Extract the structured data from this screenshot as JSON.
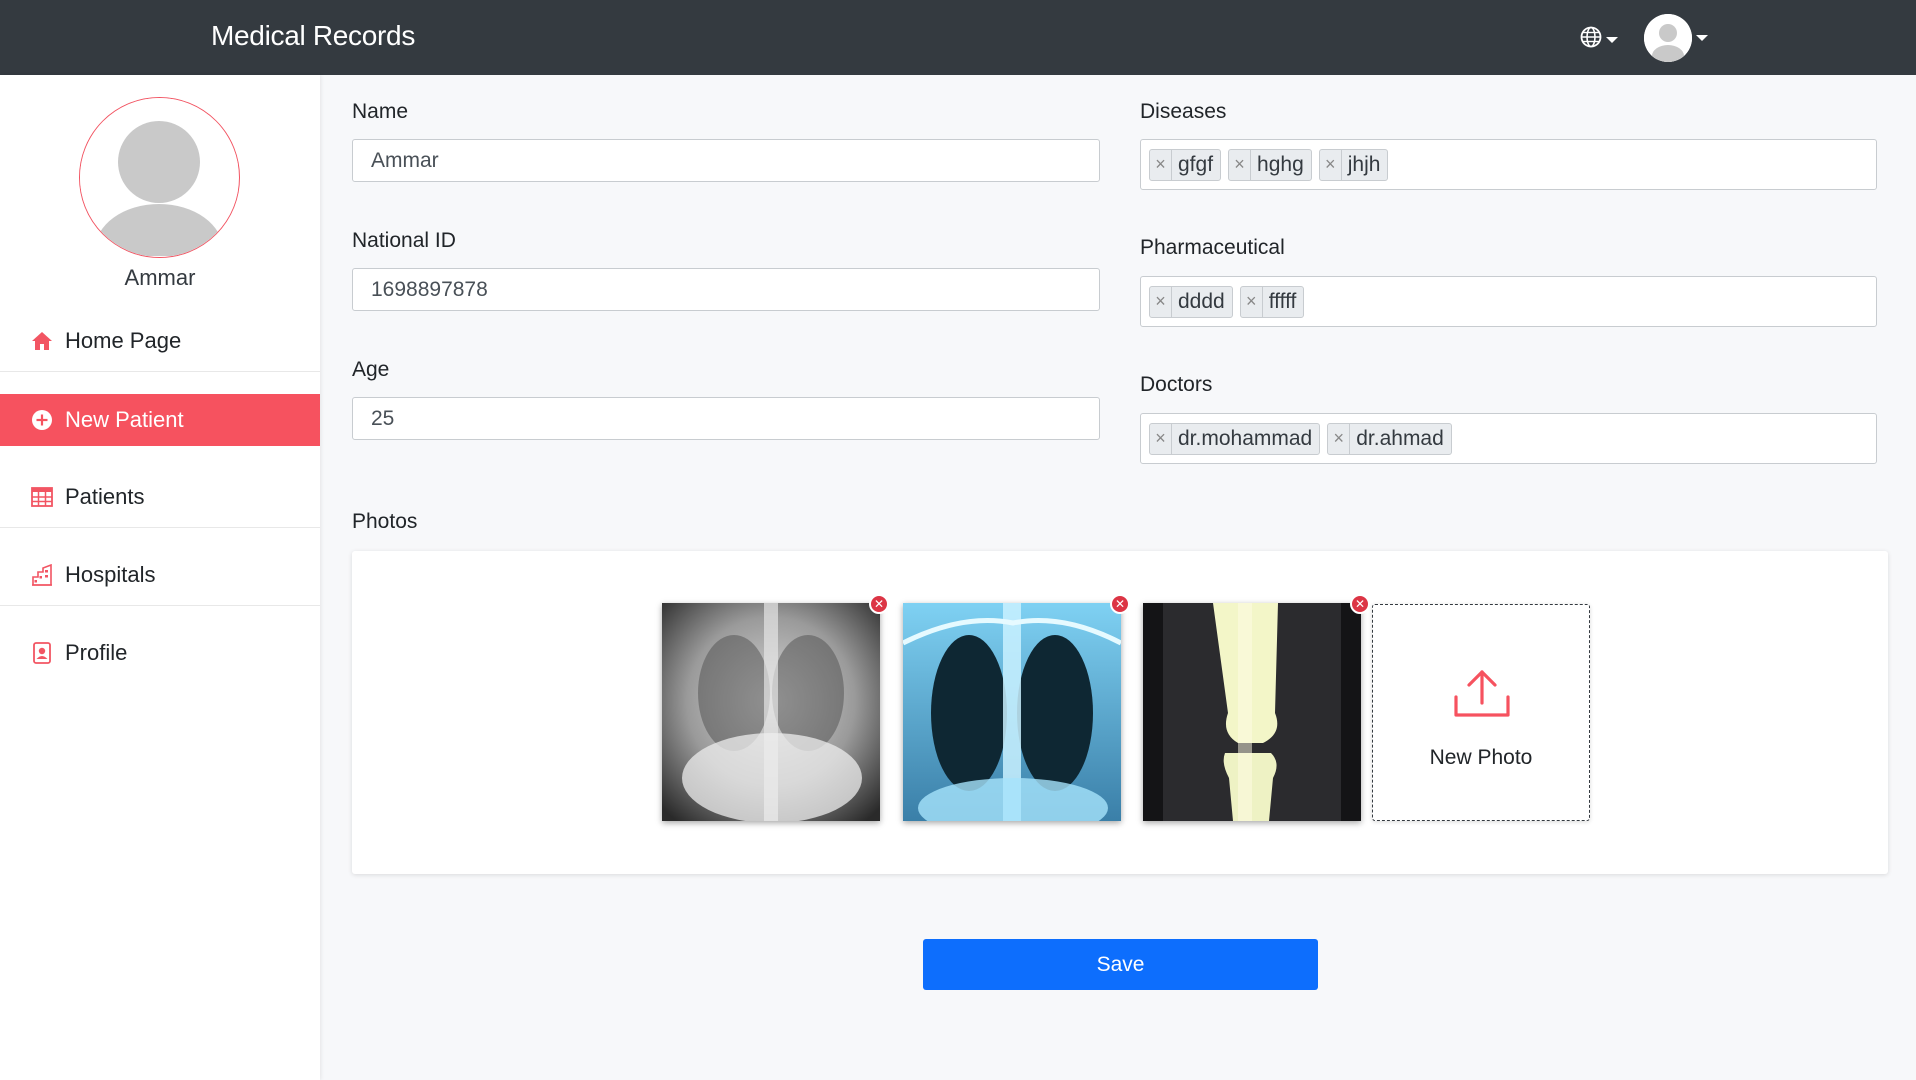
{
  "header": {
    "brand": "Medical Records",
    "language_icon": "globe-icon",
    "user_icon": "user-avatar"
  },
  "sidebar": {
    "username": "Ammar",
    "items": [
      {
        "label": "Home Page",
        "icon": "home-icon",
        "active": false
      },
      {
        "label": "New Patient",
        "icon": "plus-circle-icon",
        "active": true
      },
      {
        "label": "Patients",
        "icon": "table-icon",
        "active": false
      },
      {
        "label": "Hospitals",
        "icon": "building-icon",
        "active": false
      },
      {
        "label": "Profile",
        "icon": "profile-badge-icon",
        "active": false
      }
    ]
  },
  "form": {
    "name_label": "Name",
    "name_value": "Ammar",
    "national_id_label": "National ID",
    "national_id_value": "1698897878",
    "age_label": "Age",
    "age_value": "25",
    "diseases_label": "Diseases",
    "diseases": [
      "gfgf",
      "hghg",
      "jhjh"
    ],
    "pharmaceutical_label": "Pharmaceutical",
    "pharmaceutical": [
      "dddd",
      "fffff"
    ],
    "doctors_label": "Doctors",
    "doctors": [
      "dr.mohammad",
      "dr.ahmad"
    ],
    "photos_label": "Photos",
    "new_photo_label": "New Photo",
    "save_label": "Save"
  },
  "colors": {
    "accent": "#f6525f",
    "topbar": "#343a40",
    "primary_button": "#0d6efd",
    "remove_badge": "#dc3545"
  }
}
